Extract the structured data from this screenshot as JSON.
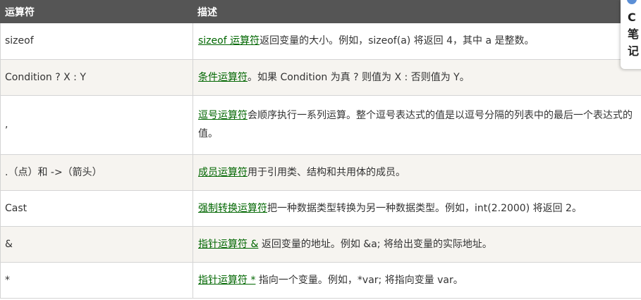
{
  "table": {
    "headers": [
      "运算符",
      "描述"
    ],
    "rows": [
      {
        "operator": "sizeof",
        "link": "sizeof 运算符",
        "text": "返回变量的大小。例如，sizeof(a) 将返回 4，其中 a 是整数。"
      },
      {
        "operator": "Condition ? X : Y",
        "link": "条件运算符",
        "text": "。如果 Condition 为真 ? 则值为 X : 否则值为 Y。"
      },
      {
        "operator": ",",
        "link": "逗号运算符",
        "text": "会顺序执行一系列运算。整个逗号表达式的值是以逗号分隔的列表中的最后一个表达式的值。"
      },
      {
        "operator": ".（点）和 ->（箭头）",
        "link": "成员运算符",
        "text": "用于引用类、结构和共用体的成员。"
      },
      {
        "operator": "Cast",
        "link": "强制转换运算符",
        "text": "把一种数据类型转换为另一种数据类型。例如，int(2.2000) 将返回 2。"
      },
      {
        "operator": "&",
        "link": "指针运算符 &",
        "text": " 返回变量的地址。例如 &a; 将给出变量的实际地址。"
      },
      {
        "operator": "*",
        "link": "指针运算符 *",
        "text": " 指向一个变量。例如，*var; 将指向变量 var。"
      }
    ]
  },
  "side_panel": {
    "line1": "C",
    "line2": "笔",
    "line3": "记"
  },
  "colors": {
    "header_bg": "#555555",
    "link": "#006600",
    "alt_row": "#f6f4f0"
  }
}
